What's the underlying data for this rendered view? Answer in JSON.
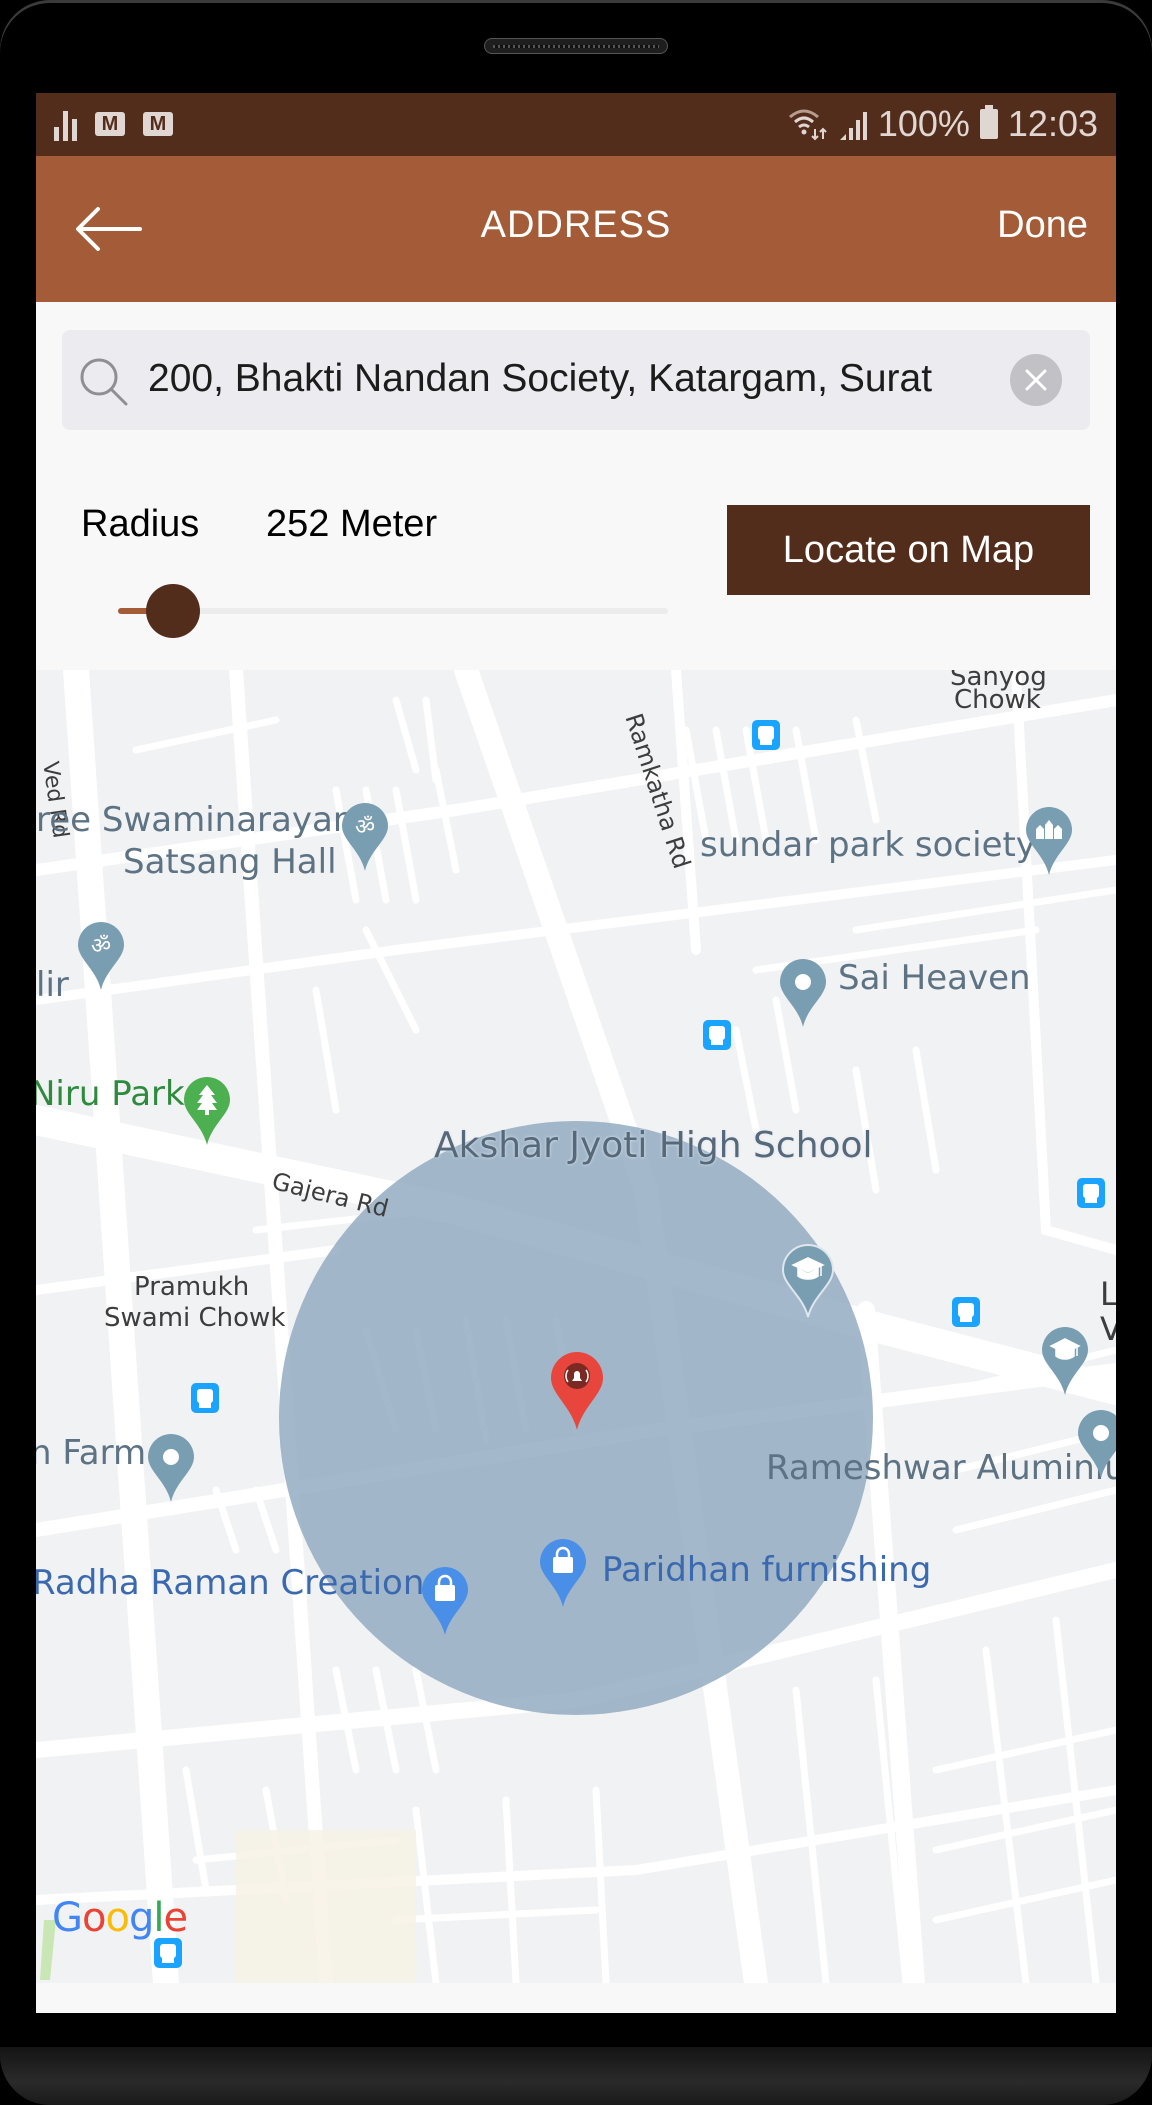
{
  "device": {
    "frame": "android-phone"
  },
  "status_bar": {
    "left_icons": [
      "signal-stats-icon",
      "gmail-icon",
      "gmail-icon"
    ],
    "right_icons": [
      "wifi-icon",
      "cellular-signal-icon"
    ],
    "battery_percent": "100%",
    "time": "12:03"
  },
  "app_bar": {
    "back_icon": "arrow-left-icon",
    "title": "ADDRESS",
    "done_label": "Done"
  },
  "search": {
    "icon": "search-icon",
    "value": "200, Bhakti Nandan Society, Katargam, Surat",
    "clear_icon": "close-icon"
  },
  "radius": {
    "label": "Radius",
    "value_text": "252 Meter",
    "slider_fraction": 0.1
  },
  "locate_button": {
    "label": "Locate on Map"
  },
  "colors": {
    "status_bar": "#532d1b",
    "app_bar": "#a45b37",
    "accent_dark": "#532d1b",
    "radius_circle": "#8fa8bf",
    "selected_pin": "#e8453c"
  },
  "map": {
    "provider_logo": "Google",
    "radius_circle_meters": 252,
    "road_labels": [
      "Ved Rd",
      "Ramkatha Rd",
      "Gajera Rd"
    ],
    "place_labels": [
      {
        "text": "Sanyog",
        "kind": "area"
      },
      {
        "text": "Chowk",
        "kind": "area"
      },
      {
        "text": "ree Swaminarayan",
        "kind": "temple"
      },
      {
        "text": "Satsang Hall",
        "kind": "temple"
      },
      {
        "text": "sundar park society",
        "kind": "residential"
      },
      {
        "text": "lir",
        "kind": "temple"
      },
      {
        "text": "Sai Heaven",
        "kind": "place"
      },
      {
        "text": "Niru Park",
        "kind": "park"
      },
      {
        "text": "Akshar Jyoti High School",
        "kind": "school"
      },
      {
        "text": "Pramukh",
        "kind": "area"
      },
      {
        "text": "Swami Chowk",
        "kind": "area"
      },
      {
        "text": "L",
        "kind": "school"
      },
      {
        "text": "V",
        "kind": "school"
      },
      {
        "text": "n Farm",
        "kind": "place"
      },
      {
        "text": "Rameshwar Aluminiur",
        "kind": "place"
      },
      {
        "text": "Radha Raman Creations",
        "kind": "shop"
      },
      {
        "text": "Paridhan furnishing",
        "kind": "shop"
      }
    ]
  }
}
